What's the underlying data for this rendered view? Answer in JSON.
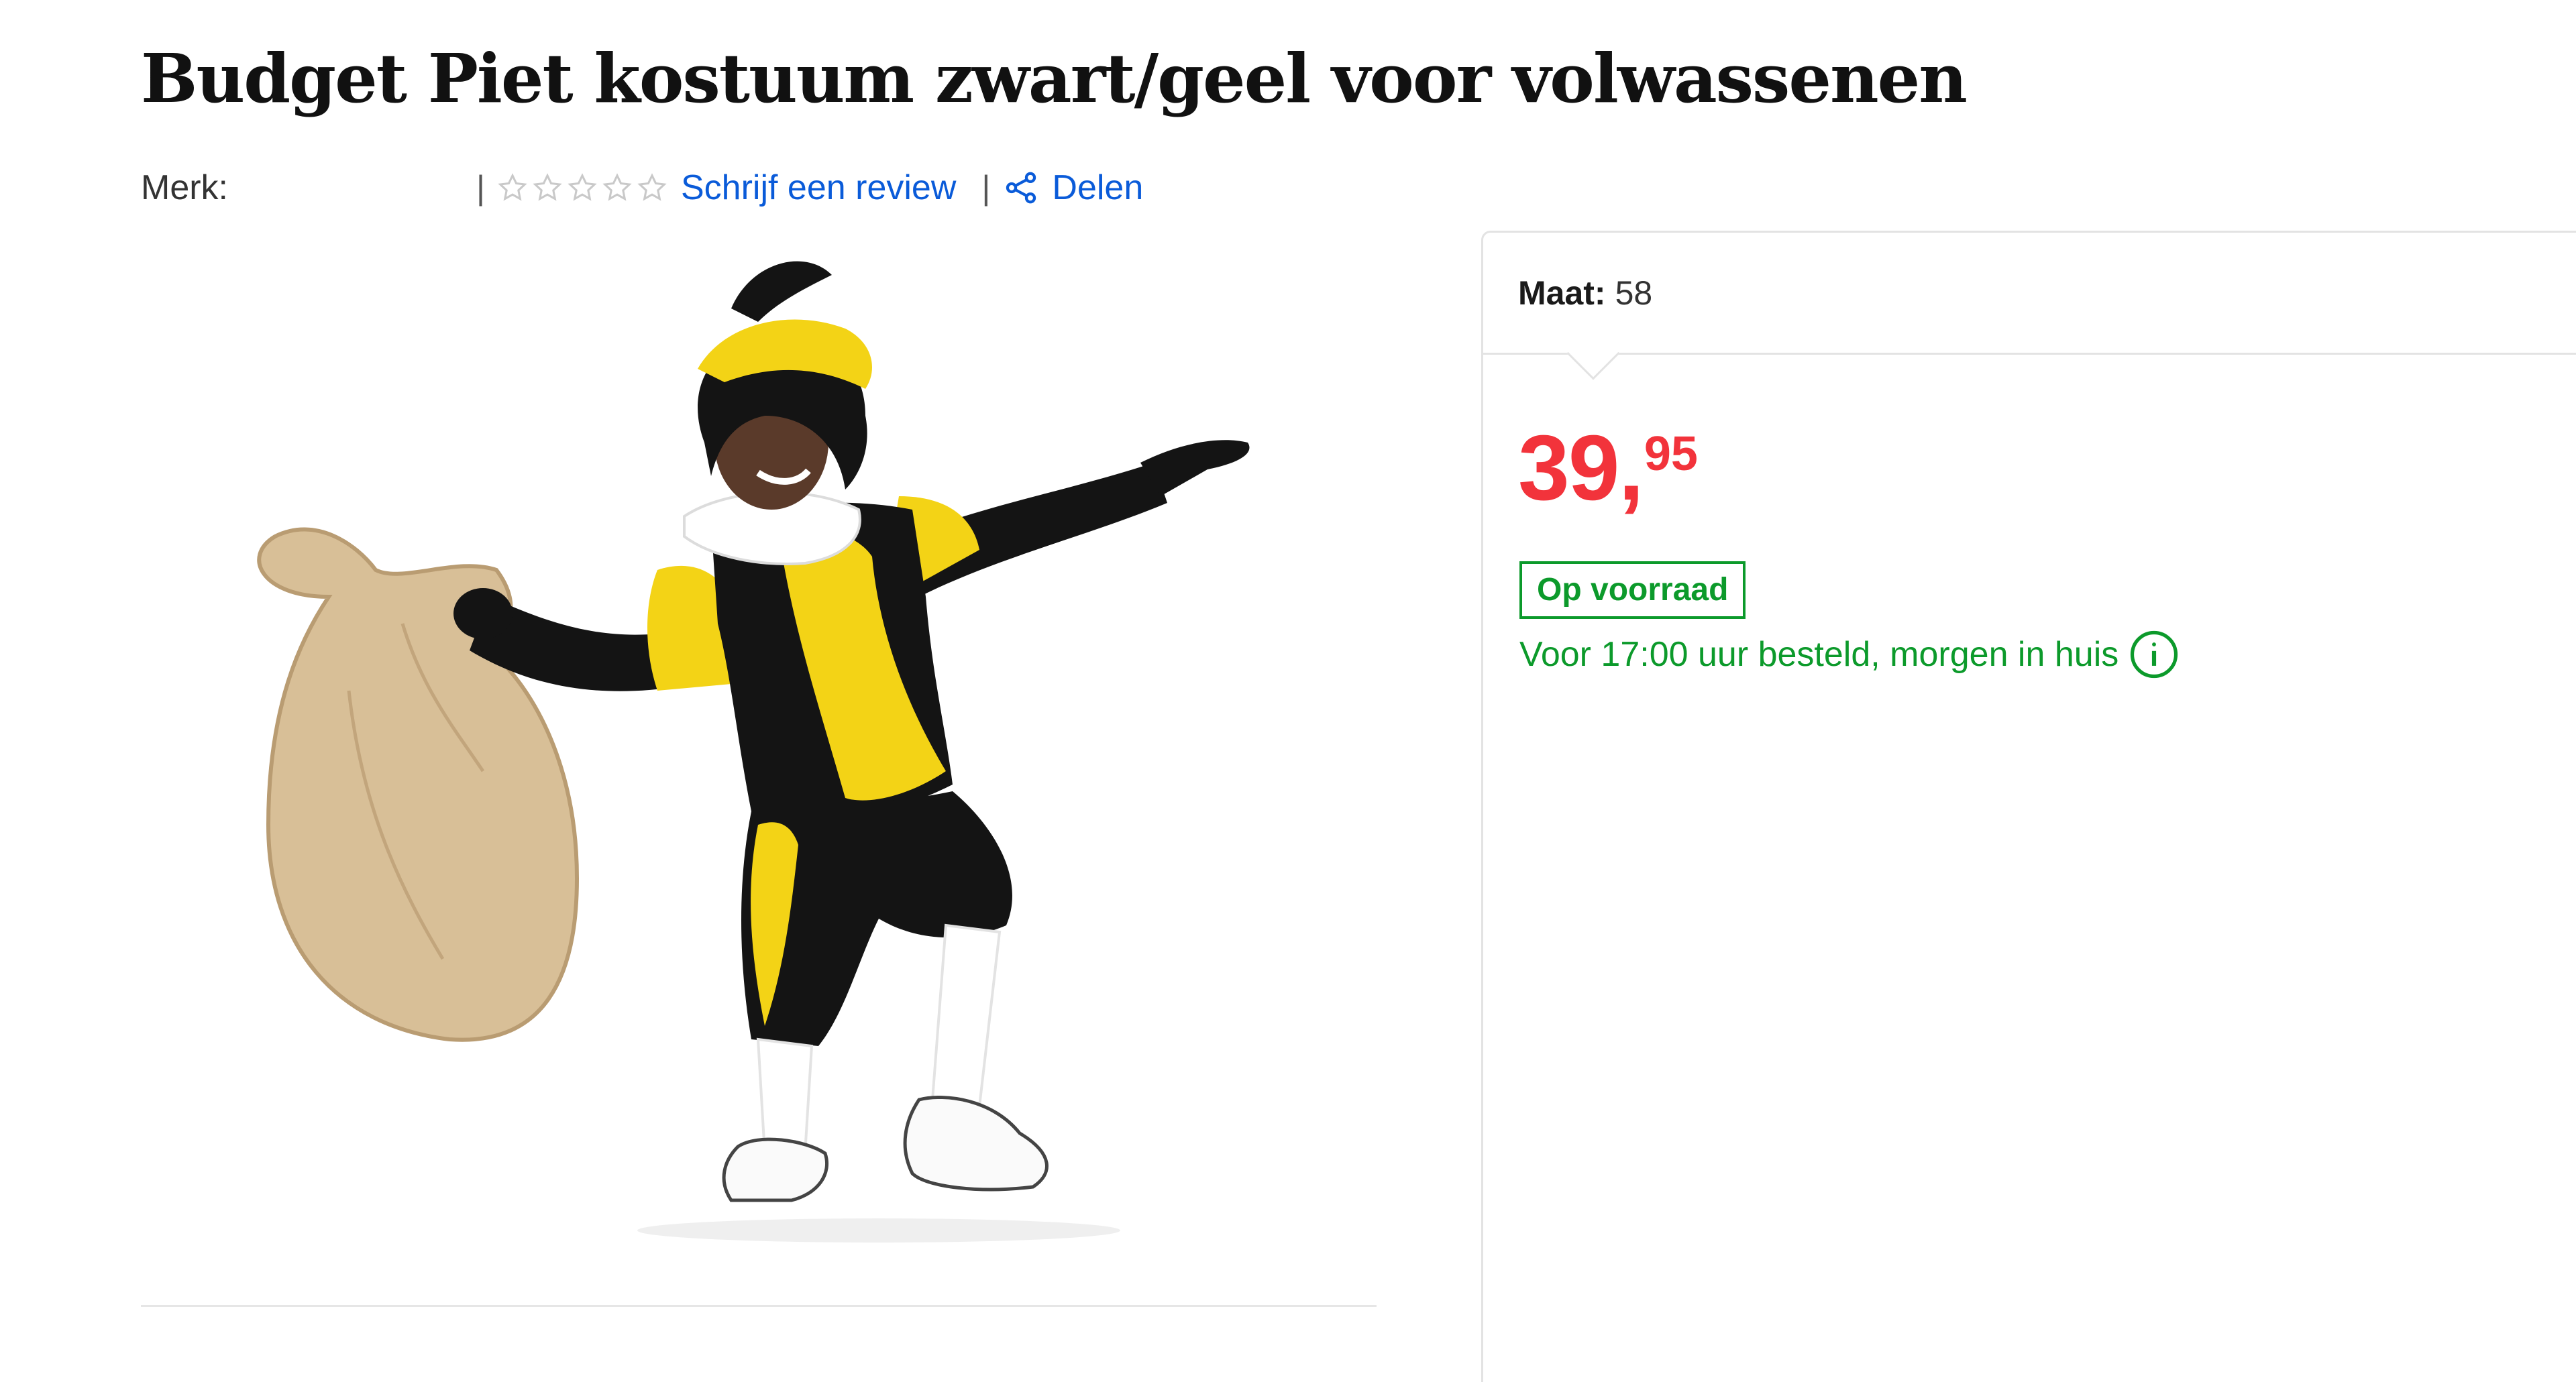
{
  "product": {
    "title": "Budget Piet kostuum zwart/geel voor volwassenen",
    "brand_label": "Merk:",
    "review_link": "Schrijf een review",
    "share_link": "Delen",
    "rating_stars": 0,
    "rating_max": 5,
    "image_alt": "Man in zwart/geel Piet kostuum met jute zak"
  },
  "buy_box": {
    "size_label": "Maat:",
    "size_value": "58",
    "price_main": "39,",
    "price_cents": "95",
    "stock_status": "Op voorraad",
    "delivery_text": "Voor 17:00 uur besteld, morgen in huis"
  },
  "colors": {
    "link": "#0a5bd9",
    "price": "#f2333b",
    "stock_green": "#0c9a2b",
    "costume_yellow": "#f3d316",
    "costume_black": "#141414"
  },
  "icons": {
    "rating": "star-outline-icon",
    "share": "share-icon",
    "info": "info-circle-icon"
  }
}
